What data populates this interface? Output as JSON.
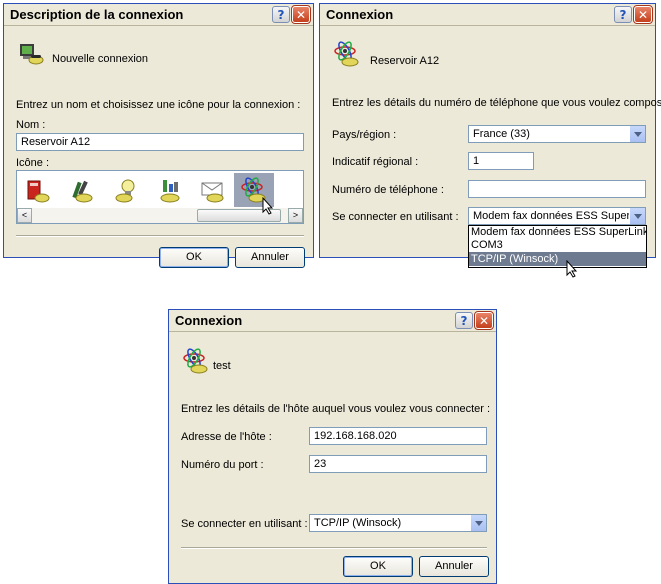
{
  "d1": {
    "title": "Description de la connexion",
    "header_name": "Nouvelle connexion",
    "instruction": "Entrez un nom et choisissez une icône pour la connexion :",
    "name_label": "Nom :",
    "name_value": "Reservoir A12",
    "icon_label": "Icône :",
    "ok": "OK",
    "cancel": "Annuler"
  },
  "d2": {
    "title": "Connexion",
    "header_name": "Reservoir A12",
    "instruction": "Entrez les détails du numéro de téléphone que vous voulez composer :",
    "country_label": "Pays/région :",
    "country_value": "France (33)",
    "area_label": "Indicatif régional :",
    "area_value": "1",
    "phone_label": "Numéro de téléphone :",
    "phone_value": "",
    "connect_label": "Se connecter en utilisant :",
    "connect_value": "Modem fax données ESS SuperLin",
    "options": [
      "Modem fax données ESS SuperLink-M",
      "COM3",
      "TCP/IP (Winsock)"
    ]
  },
  "d3": {
    "title": "Connexion",
    "header_name": "test",
    "instruction": "Entrez les détails de l'hôte auquel vous voulez vous connecter :",
    "host_label": "Adresse de l'hôte :",
    "host_value": "192.168.168.020",
    "port_label": "Numéro du port :",
    "port_value": "23",
    "connect_label": "Se connecter en utilisant :",
    "connect_value": "TCP/IP (Winsock)",
    "ok": "OK",
    "cancel": "Annuler"
  },
  "titlebar_buttons": {
    "help": "?",
    "close": "✕"
  },
  "colors": {
    "face": "#ece9d8",
    "border": "#2a4fb8",
    "selection": "#6d7a8f",
    "close": "#c3401c"
  }
}
